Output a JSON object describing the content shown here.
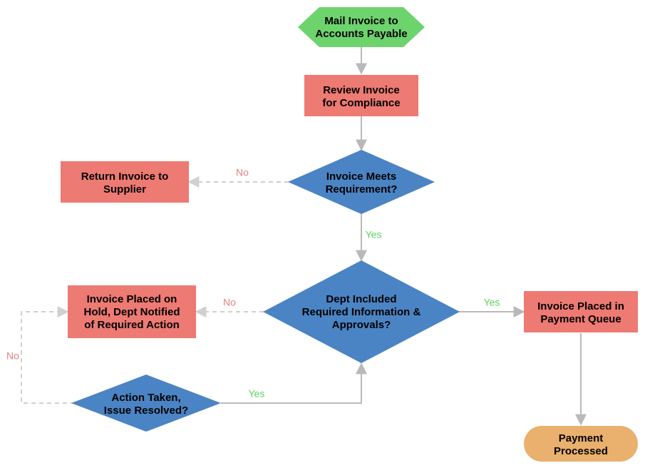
{
  "nodes": {
    "start": {
      "line1": "Mail Invoice to",
      "line2": "Accounts Payable"
    },
    "review": {
      "line1": "Review Invoice",
      "line2": "for Compliance"
    },
    "meets": {
      "line1": "Invoice Meets",
      "line2": "Requirement?"
    },
    "return": {
      "line1": "Return Invoice to",
      "line2": "Supplier"
    },
    "dept": {
      "line1": "Dept Included",
      "line2": "Required Information &",
      "line3": "Approvals?"
    },
    "hold": {
      "line1": "Invoice Placed on",
      "line2": "Hold, Dept Notified",
      "line3": "of Required Action"
    },
    "queue": {
      "line1": "Invoice Placed in",
      "line2": "Payment Queue"
    },
    "action": {
      "line1": "Action Taken,",
      "line2": "Issue Resolved?"
    },
    "processed": {
      "line1": "Payment",
      "line2": "Processed"
    }
  },
  "edges": {
    "yes": "Yes",
    "no": "No"
  },
  "colors": {
    "green": "#6dd36d",
    "red": "#ed7a73",
    "blue": "#4a84c4",
    "orange": "#eab06e",
    "arrow": "#b9b9b9",
    "dashArrow": "#d0d0d0"
  }
}
